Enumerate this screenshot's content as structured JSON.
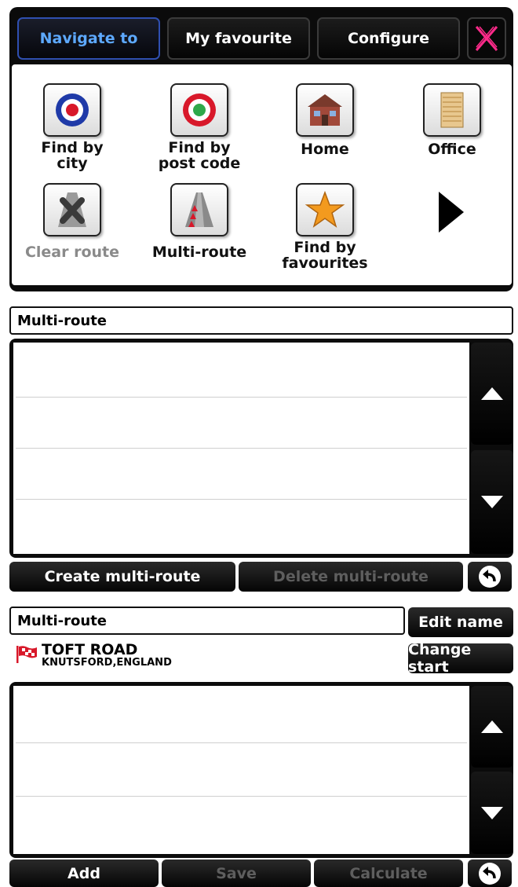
{
  "tabs": [
    {
      "label": "Navigate to",
      "active": true
    },
    {
      "label": "My favourite",
      "active": false
    },
    {
      "label": "Configure",
      "active": false
    }
  ],
  "menu_items": [
    {
      "label_line1": "Find by",
      "label_line2": "city",
      "icon": "target-blue-icon"
    },
    {
      "label_line1": "Find by",
      "label_line2": "post code",
      "icon": "target-green-icon"
    },
    {
      "label_line1": "Home",
      "label_line2": "",
      "icon": "home-icon"
    },
    {
      "label_line1": "Office",
      "label_line2": "",
      "icon": "office-icon"
    },
    {
      "label_line1": "Clear route",
      "label_line2": "",
      "icon": "clear-route-icon",
      "disabled": true
    },
    {
      "label_line1": "Multi-route",
      "label_line2": "",
      "icon": "multi-route-icon"
    },
    {
      "label_line1": "Find by",
      "label_line2": "favourites",
      "icon": "star-icon"
    }
  ],
  "multiroute_list": {
    "title": "Multi-route",
    "create_label": "Create multi-route",
    "delete_label": "Delete multi-route"
  },
  "multiroute_edit": {
    "name": "Multi-route",
    "edit_name_label": "Edit name",
    "change_start_label": "Change start",
    "start_street": "TOFT ROAD",
    "start_place": "KNUTSFORD,ENGLAND",
    "add_label": "Add",
    "save_label": "Save",
    "calculate_label": "Calculate"
  },
  "colors": {
    "active_tab": "#5da9ff",
    "close_icon": "#ff2a8a",
    "flag": "#d8182a"
  }
}
